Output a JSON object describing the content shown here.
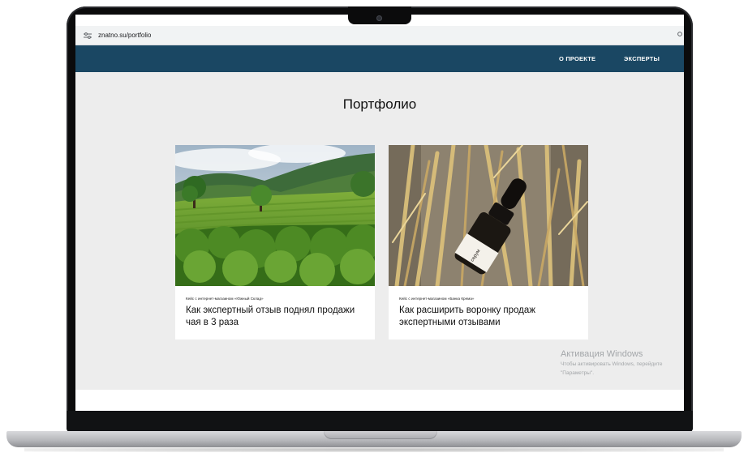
{
  "browser": {
    "url": "znatno.su/portfolio",
    "site_info_icon": "tune-icon",
    "menu_icon": "more-icon"
  },
  "header": {
    "nav": [
      {
        "label": "О ПРОЕКТЕ"
      },
      {
        "label": "ЭКСПЕРТЫ"
      }
    ],
    "background_color": "#1a4763"
  },
  "page": {
    "title": "Портфолио",
    "background_color": "#ededed"
  },
  "cards": [
    {
      "caption": "Кейс с интернет-магазином «Южный Склад»",
      "title": "Как экспертный отзыв поднял продажи чая в 3 раза",
      "image": "tea-plantation-photo"
    },
    {
      "caption": "Кейс с интернет-магазином «Банка Крема»",
      "title": "Как расширить воронку продаж экспертными отзывами",
      "image": "serum-bottle-wheat-photo"
    }
  ],
  "watermark": {
    "title": "Активация Windows",
    "line1": "Чтобы активировать Windows, перейдите",
    "line2": "\"Параметры\"."
  }
}
